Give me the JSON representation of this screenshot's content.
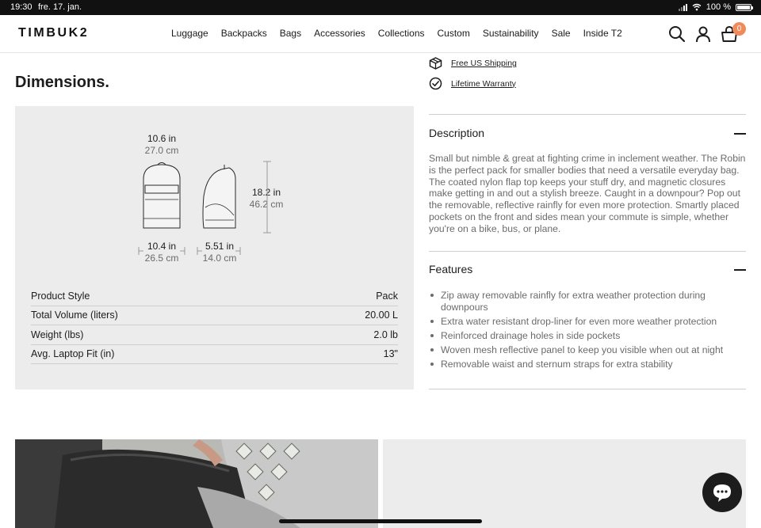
{
  "status_bar": {
    "time": "19:30",
    "date": "fre. 17. jan.",
    "battery": "100 %"
  },
  "header": {
    "logo": "TIMBUK2",
    "nav": [
      "Luggage",
      "Backpacks",
      "Bags",
      "Accessories",
      "Collections",
      "Custom",
      "Sustainability",
      "Sale",
      "Inside T2"
    ],
    "cart_count": "0",
    "accent_color": "#f08a5a"
  },
  "perks": {
    "shipping": "Free US Shipping",
    "warranty": "Lifetime Warranty"
  },
  "dimensions": {
    "title": "Dimensions.",
    "top_width": {
      "in": "10.6 in",
      "cm": "27.0 cm"
    },
    "height": {
      "in": "18.2 in",
      "cm": "46.2 cm"
    },
    "bottom_width": {
      "in": "10.4 in",
      "cm": "26.5 cm"
    },
    "depth": {
      "in": "5.51 in",
      "cm": "14.0 cm"
    }
  },
  "specs": [
    {
      "label": "Product Style",
      "value": "Pack"
    },
    {
      "label": "Total Volume (liters)",
      "value": "20.00 L"
    },
    {
      "label": "Weight (lbs)",
      "value": "2.0 lb"
    },
    {
      "label": "Avg. Laptop Fit (in)",
      "value": "13\""
    }
  ],
  "description": {
    "heading": "Description",
    "text": "Small but nimble & great at fighting crime in inclement weather. The Robin is the perfect pack for smaller bodies that need a versatile everyday bag. The coated nylon flap top keeps your stuff dry, and magnetic closures make getting in and out a stylish breeze. Caught in a downpour? Pop out the removable, reflective rainfly for even more protection. Smartly placed pockets on the front and sides mean your commute is simple, whether you're on a bike, bus, or plane."
  },
  "features": {
    "heading": "Features",
    "items": [
      "Zip away removable rainfly for extra weather protection during downpours",
      "Extra water resistant drop-liner for even more weather protection",
      "Reinforced drainage holes in side pockets",
      "Woven mesh reflective panel to keep you visible when out at night",
      "Removable waist and sternum straps for extra stability"
    ]
  }
}
